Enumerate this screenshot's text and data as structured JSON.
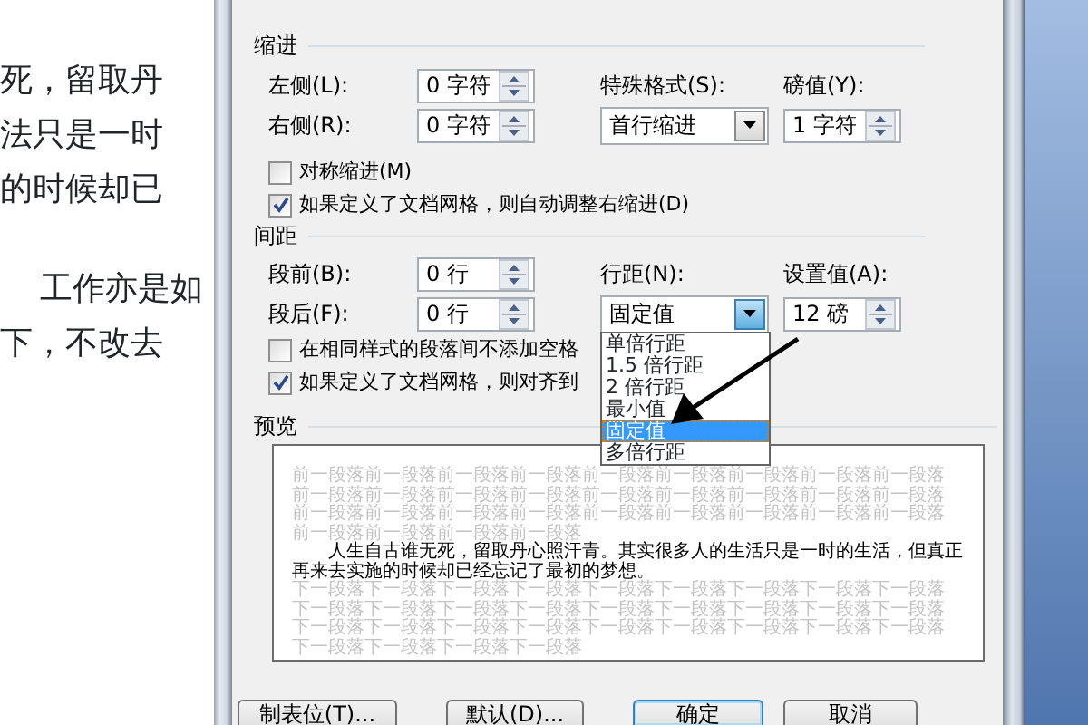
{
  "document": {
    "paragraphs": [
      {
        "lines": [
          "死，留取丹",
          "法只是一时",
          "的时候却已"
        ]
      },
      {
        "lines": [
          "工作亦是如",
          "下，不改去"
        ]
      }
    ]
  },
  "dialog": {
    "indent": {
      "title": "缩进",
      "left": {
        "label": "左侧(L):",
        "value": "0 字符"
      },
      "right": {
        "label": "右侧(R):",
        "value": "0 字符"
      },
      "special": {
        "label": "特殊格式(S):",
        "value": "首行缩进",
        "focused": false
      },
      "by": {
        "label": "磅值(Y):",
        "value": "1 字符"
      },
      "checks": [
        {
          "label": "对称缩进(M)",
          "checked": false
        },
        {
          "label": "如果定义了文档网格，则自动调整右缩进(D)",
          "checked": true
        }
      ]
    },
    "spacing": {
      "title": "间距",
      "before": {
        "label": "段前(B):",
        "value": "0 行"
      },
      "after": {
        "label": "段后(F):",
        "value": "0 行"
      },
      "line_spacing": {
        "label": "行距(N):",
        "value": "固定值",
        "focused": true
      },
      "at": {
        "label": "设置值(A):",
        "value": "12 磅"
      },
      "checks": [
        {
          "label": "在相同样式的段落间不添加空格",
          "checked": false
        },
        {
          "label": "如果定义了文档网格，则对齐到",
          "checked": true
        }
      ],
      "options": [
        {
          "label": "单倍行距",
          "selected": false
        },
        {
          "label": "1.5 倍行距",
          "selected": false
        },
        {
          "label": "2 倍行距",
          "selected": false
        },
        {
          "label": "最小值",
          "selected": false
        },
        {
          "label": "固定值",
          "selected": true
        },
        {
          "label": "多倍行距",
          "selected": false
        }
      ]
    },
    "preview": {
      "title": "预览",
      "previous_lines": [
        "前一段落前一段落前一段落前一段落前一段落前一段落前一段落前一段落前一段落",
        "前一段落前一段落前一段落前一段落前一段落前一段落前一段落前一段落前一段落",
        "前一段落前一段落前一段落前一段落前一段落前一段落前一段落前一段落前一段落",
        "前一段落前一段落前一段落前一段落"
      ],
      "text": "人生自古谁无死，留取丹心照汗青。其实很多人的生活只是一时的生活，但真正再来去实施的时候却已经忘记了最初的梦想。",
      "next_lines": [
        "下一段落下一段落下一段落下一段落下一段落下一段落下一段落下一段落下一段落",
        "下一段落下一段落下一段落下一段落下一段落下一段落下一段落下一段落下一段落",
        "下一段落下一段落下一段落下一段落下一段落下一段落下一段落下一段落下一段落",
        "下一段落下一段落下一段落下一段落"
      ]
    },
    "buttons": [
      {
        "label": "制表位(T)...",
        "default": false
      },
      {
        "label": "默认(D)...",
        "default": false
      },
      {
        "label": "确定",
        "default": true
      },
      {
        "label": "取消",
        "default": false
      }
    ]
  }
}
